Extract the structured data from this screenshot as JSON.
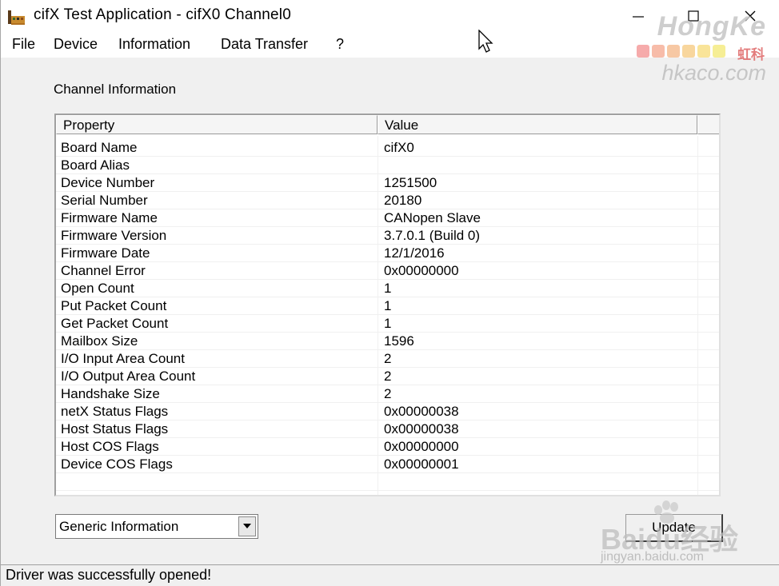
{
  "window": {
    "title": "cifX Test Application - cifX0 Channel0"
  },
  "menu": {
    "items": [
      {
        "label": "File"
      },
      {
        "label": "Device"
      },
      {
        "label": "Information"
      },
      {
        "label": "Data Transfer"
      },
      {
        "label": "?"
      }
    ]
  },
  "watermark": {
    "brand": "HongKe",
    "brand_cn": "虹科",
    "url": "hkaco.com",
    "dot_colors": [
      "#f6a3a3",
      "#f7b5a0",
      "#f7c39b",
      "#f8d293",
      "#f9e28e",
      "#f6ed8a"
    ]
  },
  "section": {
    "label": "Channel Information"
  },
  "table": {
    "columns": [
      "Property",
      "Value"
    ],
    "rows": [
      {
        "property": "Board Name",
        "value": "cifX0"
      },
      {
        "property": "Board Alias",
        "value": ""
      },
      {
        "property": "Device Number",
        "value": "1251500"
      },
      {
        "property": "Serial Number",
        "value": "20180"
      },
      {
        "property": "Firmware Name",
        "value": "CANopen Slave"
      },
      {
        "property": "Firmware Version",
        "value": "3.7.0.1 (Build 0)"
      },
      {
        "property": "Firmware Date",
        "value": "12/1/2016"
      },
      {
        "property": "Channel Error",
        "value": "0x00000000"
      },
      {
        "property": "Open Count",
        "value": "1"
      },
      {
        "property": "Put Packet Count",
        "value": "1"
      },
      {
        "property": "Get Packet Count",
        "value": "1"
      },
      {
        "property": "Mailbox Size",
        "value": "1596"
      },
      {
        "property": "I/O Input Area Count",
        "value": "2"
      },
      {
        "property": "I/O Output Area Count",
        "value": "2"
      },
      {
        "property": "Handshake Size",
        "value": "2"
      },
      {
        "property": "netX Status Flags",
        "value": "0x00000038"
      },
      {
        "property": "Host Status Flags",
        "value": "0x00000038"
      },
      {
        "property": "Host COS Flags",
        "value": "0x00000000"
      },
      {
        "property": "Device COS Flags",
        "value": "0x00000001"
      }
    ]
  },
  "controls": {
    "view_select_value": "Generic Information",
    "update_label": "Update"
  },
  "baidu_watermark": {
    "text": "Baidu经验",
    "url": "jingyan.baidu.com"
  },
  "status": {
    "text": "Driver was successfully opened!"
  }
}
